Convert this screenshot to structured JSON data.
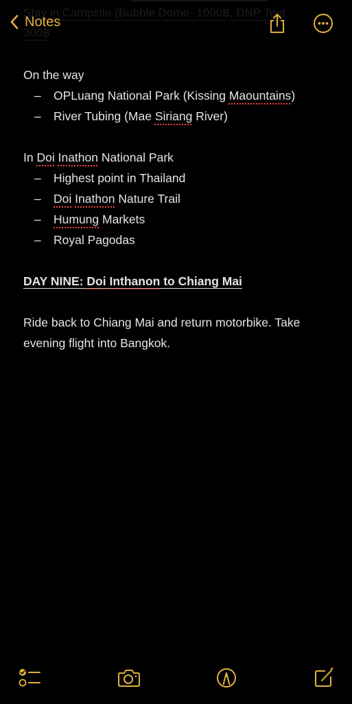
{
  "app": {
    "accent_color": "#e3b23c",
    "background_color": "#000000",
    "text_color": "#e5e5e7",
    "spellcheck_color": "#ff453a"
  },
  "ghost_text": {
    "line1": "Stay in Campsite (Bubble Dome- 1000฿, DNP Tent",
    "line2": "300฿"
  },
  "navbar": {
    "back_label": "Notes",
    "back_icon": "chevron-left-icon",
    "share_icon": "share-icon",
    "more_icon": "ellipsis-circle-icon"
  },
  "note": {
    "section1": {
      "title": "On the way",
      "bullets": [
        {
          "dash": "–",
          "before": "OPLuang National Park (Kissing ",
          "misspelled": "Maountains",
          "after": ")"
        },
        {
          "dash": "–",
          "before": "River Tubing (Mae ",
          "misspelled": "Siriang",
          "after": " River)"
        }
      ]
    },
    "section2": {
      "title_before": "In ",
      "title_misspelled_1": "Doi",
      "title_space": " ",
      "title_misspelled_2": "Inathon",
      "title_after": " National Park",
      "bullets": [
        {
          "dash": "–",
          "text": "Highest point in Thailand"
        },
        {
          "dash": "–",
          "misspelled_1": "Doi",
          "space": " ",
          "misspelled_2": "Inathon",
          "after": " Nature Trail"
        },
        {
          "dash": "–",
          "misspelled": "Humung",
          "after": " Markets"
        },
        {
          "dash": "–",
          "text": "Royal Pagodas"
        }
      ]
    },
    "heading": {
      "before": "DAY NINE: ",
      "misspelled_1": "Doi",
      "space": " ",
      "misspelled_2": "Inthanon",
      "after": " to Chiang Mai"
    },
    "paragraph": "Ride back to Chiang Mai and return motorbike. Take evening flight into Bangkok."
  },
  "toolbar": {
    "checklist_icon": "checklist-icon",
    "camera_icon": "camera-icon",
    "markup_icon": "markup-pen-icon",
    "compose_icon": "compose-icon"
  }
}
